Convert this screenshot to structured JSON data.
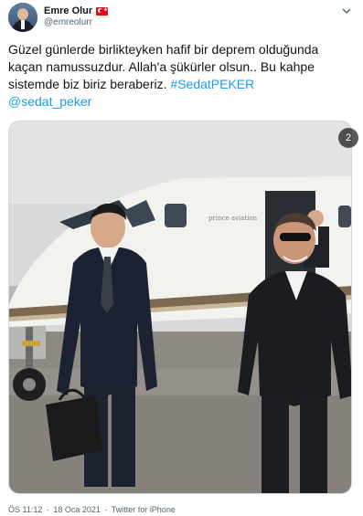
{
  "author": {
    "display_name": "Emre Olur",
    "handle": "@emreolurr",
    "flag_icon": "turkey-flag-icon"
  },
  "tweet": {
    "text_line1": "Güzel günlerde birlikteyken hafif bir deprem olduğunda",
    "text_line2": "kaçan namussuzdur. Allah'a şükürler olsun.. Bu kahpe",
    "text_line3": "sistemde biz biriz beraberiz.",
    "hashtag": "#SedatPEKER",
    "mention": "@sedat_peker"
  },
  "media": {
    "count_badge": "2",
    "jet_lettering": "prince aviation",
    "colors": {
      "sky": "#d9dcdd",
      "jet": "#f3f3f1",
      "stripe": "#7a6a52",
      "tarmac": "#8f8a83",
      "suit": "#1c1f26"
    }
  },
  "footer": {
    "time": "ÖS 11:12",
    "separator": "·",
    "date": "18 Oca 2021",
    "source": "Twitter for iPhone"
  },
  "colors": {
    "link": "#1d9bf0",
    "secondary_text": "#536471",
    "primary_text": "#0f1419"
  }
}
